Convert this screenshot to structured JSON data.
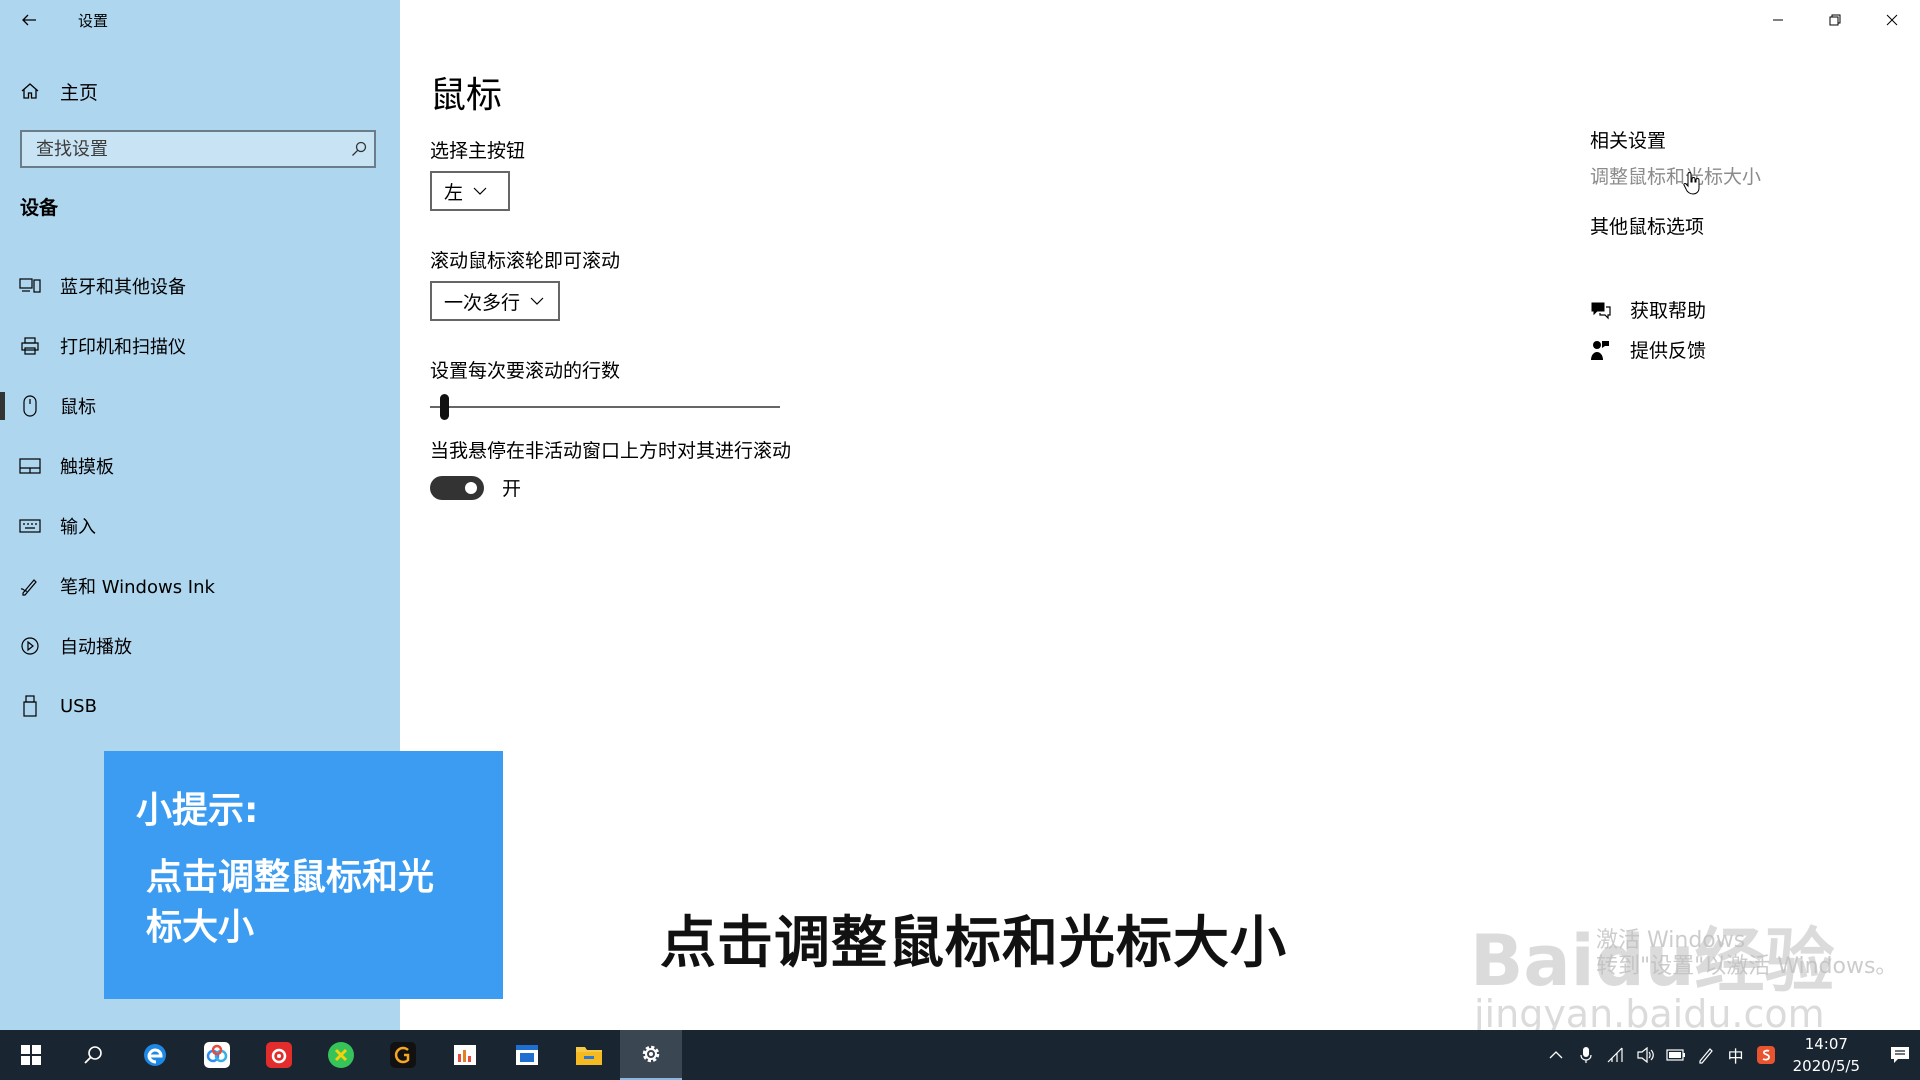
{
  "window": {
    "title": "设置"
  },
  "sidebar": {
    "home_label": "主页",
    "search_placeholder": "查找设置",
    "section_title": "设备",
    "items": [
      {
        "label": "蓝牙和其他设备",
        "icon": "bluetooth-devices-icon"
      },
      {
        "label": "打印机和扫描仪",
        "icon": "printer-icon"
      },
      {
        "label": "鼠标",
        "icon": "mouse-icon",
        "selected": true
      },
      {
        "label": "触摸板",
        "icon": "touchpad-icon"
      },
      {
        "label": "输入",
        "icon": "keyboard-icon"
      },
      {
        "label": "笔和 Windows Ink",
        "icon": "pen-icon"
      },
      {
        "label": "自动播放",
        "icon": "autoplay-icon"
      },
      {
        "label": "USB",
        "icon": "usb-icon"
      }
    ]
  },
  "tip": {
    "title": "小提示:",
    "body": "点击调整鼠标和光标大小"
  },
  "main": {
    "title": "鼠标",
    "primary_button_label": "选择主按钮",
    "primary_button_value": "左",
    "scroll_label": "滚动鼠标滚轮即可滚动",
    "scroll_value": "一次多行",
    "lines_label": "设置每次要滚动的行数",
    "lines_slider_fraction": 0.03,
    "inactive_scroll_label": "当我悬停在非活动窗口上方时对其进行滚动",
    "inactive_scroll_state": "开",
    "inactive_scroll_on": true
  },
  "related": {
    "title": "相关设置",
    "links": [
      "调整鼠标和光标大小",
      "其他鼠标选项"
    ],
    "get_help": "获取帮助",
    "give_feedback": "提供反馈"
  },
  "overlay": {
    "subtitle": "点击调整鼠标和光标大小",
    "watermark": "Baidu经验",
    "watermark_url": "jingyan.baidu.com",
    "activate_line1": "激活 Windows",
    "activate_line2": "转到\"设置\"以激活 Windows。"
  },
  "taskbar": {
    "ime": "中",
    "time": "14:07",
    "date": "2020/5/5"
  },
  "colors": {
    "sidebar_bg": "#aed6ef",
    "tip_bg": "#3b9cf2",
    "taskbar_bg": "#1a2532"
  }
}
